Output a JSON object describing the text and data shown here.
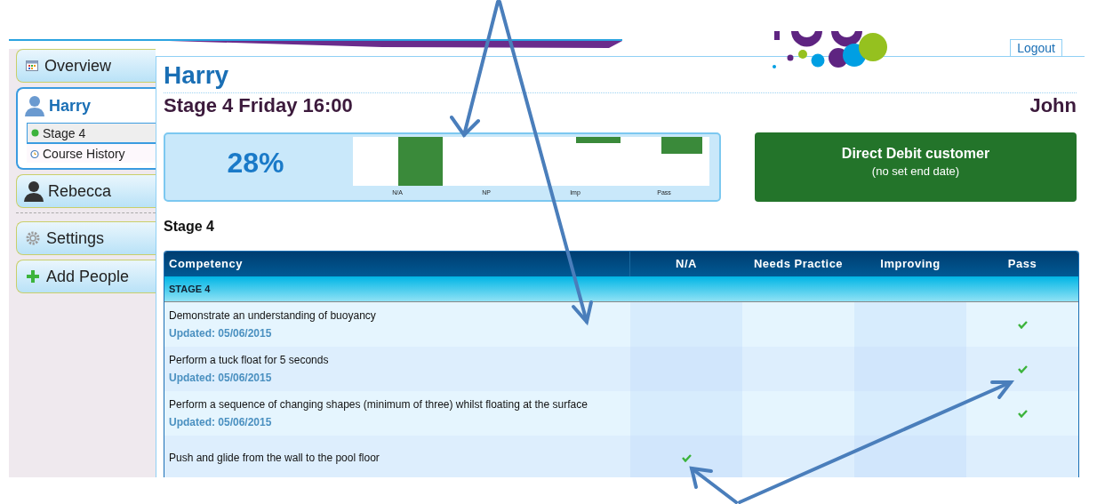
{
  "header": {
    "logout": "Logout"
  },
  "sidebar": {
    "items": [
      {
        "kind": "overview",
        "label": "Overview",
        "selected": false
      },
      {
        "kind": "person",
        "label": "Harry",
        "selected": true,
        "children": [
          {
            "kind": "stage",
            "label": "Stage 4",
            "selected": true
          },
          {
            "kind": "history",
            "label": "Course History",
            "selected": false
          }
        ]
      },
      {
        "kind": "person",
        "label": "Rebecca",
        "selected": false
      },
      {
        "kind": "divider"
      },
      {
        "kind": "settings",
        "label": "Settings",
        "selected": false
      },
      {
        "kind": "add",
        "label": "Add People",
        "selected": false
      }
    ]
  },
  "main": {
    "title": "Harry",
    "subtitle": "Stage 4 Friday 16:00",
    "teacher": "John",
    "progress": {
      "percent": "28%",
      "bar_labels": [
        "N/A",
        "NP",
        "Imp",
        "Pass"
      ]
    },
    "membership": {
      "title": "Direct Debit customer",
      "note": "(no set end date)"
    },
    "section_title": "Stage 4",
    "table": {
      "columns": [
        "Competency",
        "N/A",
        "Needs Practice",
        "Improving",
        "Pass"
      ],
      "group": "STAGE 4",
      "rows": [
        {
          "competency": "Demonstrate an understanding of buoyancy",
          "updated": "Updated: 05/06/2015",
          "cells": [
            {
              "checked": false
            },
            {
              "checked": false
            },
            {
              "checked": false
            },
            {
              "checked": true
            }
          ]
        },
        {
          "competency": "Perform a tuck float for 5 seconds",
          "updated": "Updated: 05/06/2015",
          "cells": [
            {
              "checked": false
            },
            {
              "checked": false
            },
            {
              "checked": false
            },
            {
              "checked": true
            }
          ]
        },
        {
          "competency": "Perform a sequence of changing shapes (minimum of three) whilst floating at the surface",
          "updated": "Updated: 05/06/2015",
          "cells": [
            {
              "checked": false
            },
            {
              "checked": false
            },
            {
              "checked": false
            },
            {
              "checked": true
            }
          ]
        },
        {
          "competency": "Push and glide from the wall to the pool floor",
          "cells": [
            {
              "checked": true
            },
            {
              "checked": false
            },
            {
              "checked": false
            },
            {
              "checked": false
            }
          ]
        }
      ]
    }
  }
}
